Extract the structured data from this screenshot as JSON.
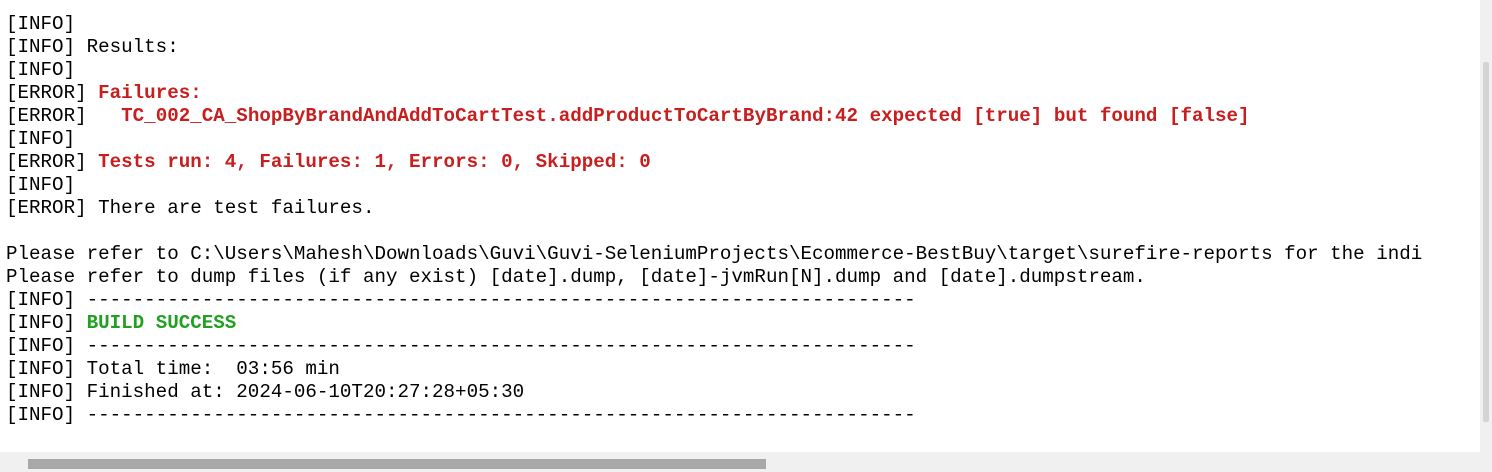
{
  "console": {
    "lines": [
      [
        {
          "text": "[INFO]",
          "style": "plain"
        }
      ],
      [
        {
          "text": "[INFO] Results:",
          "style": "plain"
        }
      ],
      [
        {
          "text": "[INFO]",
          "style": "plain"
        }
      ],
      [
        {
          "text": "[ERROR] ",
          "style": "plain"
        },
        {
          "text": "Failures:",
          "style": "err"
        }
      ],
      [
        {
          "text": "[ERROR]   ",
          "style": "plain"
        },
        {
          "text": "TC_002_CA_ShopByBrandAndAddToCartTest.addProductToCartByBrand:42 expected [true] but found [false]",
          "style": "err"
        }
      ],
      [
        {
          "text": "[INFO]",
          "style": "plain"
        }
      ],
      [
        {
          "text": "[ERROR] ",
          "style": "plain"
        },
        {
          "text": "Tests run: 4, Failures: 1, Errors: 0, Skipped: 0",
          "style": "err"
        }
      ],
      [
        {
          "text": "[INFO]",
          "style": "plain"
        }
      ],
      [
        {
          "text": "[ERROR] There are test failures.",
          "style": "plain"
        }
      ],
      [
        {
          "text": "",
          "style": "plain"
        }
      ],
      [
        {
          "text": "Please refer to C:\\Users\\Mahesh\\Downloads\\Guvi\\Guvi-SeleniumProjects\\Ecommerce-BestBuy\\target\\surefire-reports for the indi",
          "style": "plain"
        }
      ],
      [
        {
          "text": "Please refer to dump files (if any exist) [date].dump, [date]-jvmRun[N].dump and [date].dumpstream.",
          "style": "plain"
        }
      ],
      [
        {
          "text": "[INFO] ------------------------------------------------------------------------",
          "style": "plain"
        }
      ],
      [
        {
          "text": "[INFO] ",
          "style": "plain"
        },
        {
          "text": "BUILD SUCCESS",
          "style": "ok"
        }
      ],
      [
        {
          "text": "[INFO] ------------------------------------------------------------------------",
          "style": "plain"
        }
      ],
      [
        {
          "text": "[INFO] Total time:  03:56 min",
          "style": "plain"
        }
      ],
      [
        {
          "text": "[INFO] Finished at: 2024-06-10T20:27:28+05:30",
          "style": "plain"
        }
      ],
      [
        {
          "text": "[INFO] ------------------------------------------------------------------------",
          "style": "plain"
        }
      ]
    ]
  },
  "colors": {
    "error_text": "#c81e1e",
    "success_text": "#21a021",
    "default_text": "#000000",
    "background": "#ffffff"
  }
}
